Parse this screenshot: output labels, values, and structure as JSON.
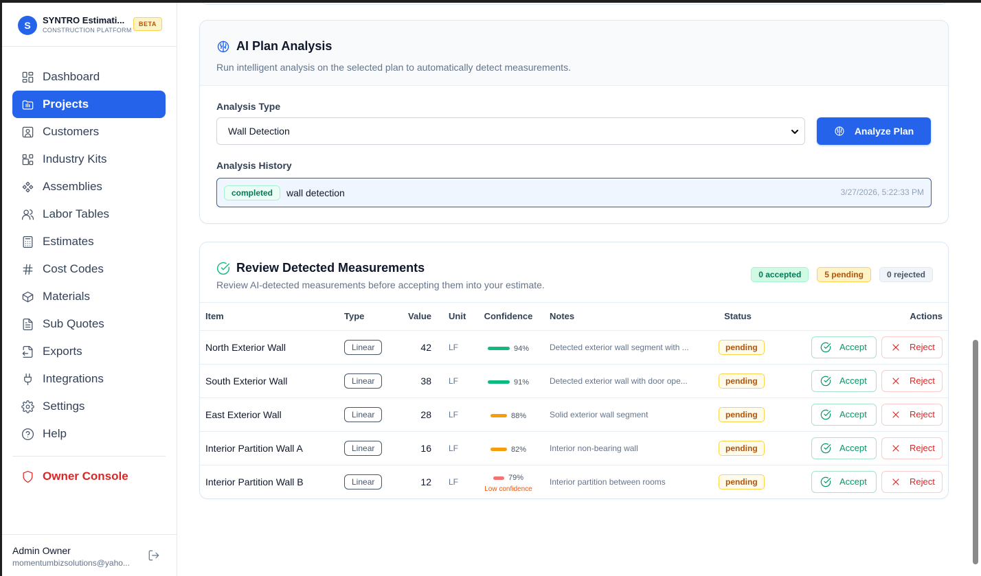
{
  "app": {
    "name": "SYNTRO Estimati...",
    "subtitle": "CONSTRUCTION PLATFORM",
    "badge": "BETA",
    "logo_letter": "S"
  },
  "sidebar": {
    "items": [
      {
        "label": "Dashboard",
        "icon": "dashboard-icon"
      },
      {
        "label": "Projects",
        "icon": "projects-icon",
        "active": true
      },
      {
        "label": "Customers",
        "icon": "customers-icon"
      },
      {
        "label": "Industry Kits",
        "icon": "industry-kits-icon"
      },
      {
        "label": "Assemblies",
        "icon": "assemblies-icon"
      },
      {
        "label": "Labor Tables",
        "icon": "labor-tables-icon"
      },
      {
        "label": "Estimates",
        "icon": "estimates-icon"
      },
      {
        "label": "Cost Codes",
        "icon": "hash-icon"
      },
      {
        "label": "Materials",
        "icon": "box-icon"
      },
      {
        "label": "Sub Quotes",
        "icon": "file-icon"
      },
      {
        "label": "Exports",
        "icon": "export-icon"
      },
      {
        "label": "Integrations",
        "icon": "plug-icon"
      },
      {
        "label": "Settings",
        "icon": "gear-icon"
      },
      {
        "label": "Help",
        "icon": "help-icon"
      }
    ],
    "owner_console": "Owner Console",
    "user": {
      "name": "Admin Owner",
      "email": "momentumbizsolutions@yaho..."
    }
  },
  "analysis": {
    "title": "AI Plan Analysis",
    "description": "Run intelligent analysis on the selected plan to automatically detect measurements.",
    "type_label": "Analysis Type",
    "type_value": "Wall Detection",
    "analyze_button": "Analyze Plan",
    "history_label": "Analysis History",
    "history": [
      {
        "status": "completed",
        "name": "wall detection",
        "timestamp": "3/27/2026, 5:22:33 PM"
      }
    ]
  },
  "review": {
    "title": "Review Detected Measurements",
    "description": "Review AI-detected measurements before accepting them into your estimate.",
    "counts": {
      "accepted": "0 accepted",
      "pending": "5 pending",
      "rejected": "0 rejected"
    },
    "columns": [
      "Item",
      "Type",
      "Value",
      "Unit",
      "Confidence",
      "Notes",
      "Status",
      "Actions"
    ],
    "accept_label": "Accept",
    "reject_label": "Reject",
    "rows": [
      {
        "item": "North Exterior Wall",
        "type": "Linear",
        "value": "42",
        "unit": "LF",
        "confidence": "94%",
        "confidence_level": 0.94,
        "confidence_color": "#10b981",
        "notes": "Detected exterior wall segment with ...",
        "status": "pending",
        "low_label": ""
      },
      {
        "item": "South Exterior Wall",
        "type": "Linear",
        "value": "38",
        "unit": "LF",
        "confidence": "91%",
        "confidence_level": 0.91,
        "confidence_color": "#10b981",
        "notes": "Detected exterior wall with door ope...",
        "status": "pending",
        "low_label": ""
      },
      {
        "item": "East Exterior Wall",
        "type": "Linear",
        "value": "28",
        "unit": "LF",
        "confidence": "88%",
        "confidence_level": 0.88,
        "confidence_color": "#f59e0b",
        "notes": "Solid exterior wall segment",
        "status": "pending",
        "low_label": ""
      },
      {
        "item": "Interior Partition Wall A",
        "type": "Linear",
        "value": "16",
        "unit": "LF",
        "confidence": "82%",
        "confidence_level": 0.82,
        "confidence_color": "#f59e0b",
        "notes": "Interior non-bearing wall",
        "status": "pending",
        "low_label": ""
      },
      {
        "item": "Interior Partition Wall B",
        "type": "Linear",
        "value": "12",
        "unit": "LF",
        "confidence": "79%",
        "confidence_level": 0.79,
        "confidence_color": "#f87171",
        "notes": "Interior partition between rooms",
        "status": "pending",
        "low_label": "Low confidence"
      }
    ]
  }
}
